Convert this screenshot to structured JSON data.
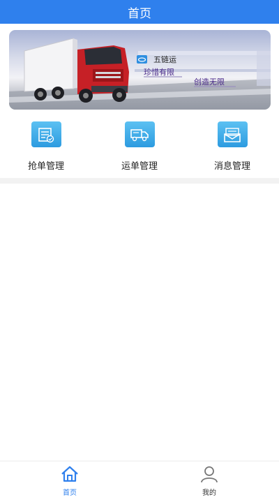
{
  "header": {
    "title": "首页"
  },
  "banner": {
    "brand_name": "五链运",
    "slogan_left": "珍惜有限",
    "slogan_right": "创造无限"
  },
  "menu": {
    "items": [
      {
        "label": "抢单管理",
        "icon": "order-grab-icon"
      },
      {
        "label": "运单管理",
        "icon": "truck-icon"
      },
      {
        "label": "消息管理",
        "icon": "message-icon"
      }
    ]
  },
  "tabbar": {
    "items": [
      {
        "label": "首页",
        "icon": "home-icon",
        "active": true
      },
      {
        "label": "我的",
        "icon": "user-icon",
        "active": false
      }
    ]
  },
  "colors": {
    "primary": "#2f80ed",
    "icon_gradient_top": "#5cc1f2",
    "icon_gradient_bottom": "#2d9be0",
    "tab_active": "#2f80ed",
    "tab_inactive": "#666666"
  }
}
